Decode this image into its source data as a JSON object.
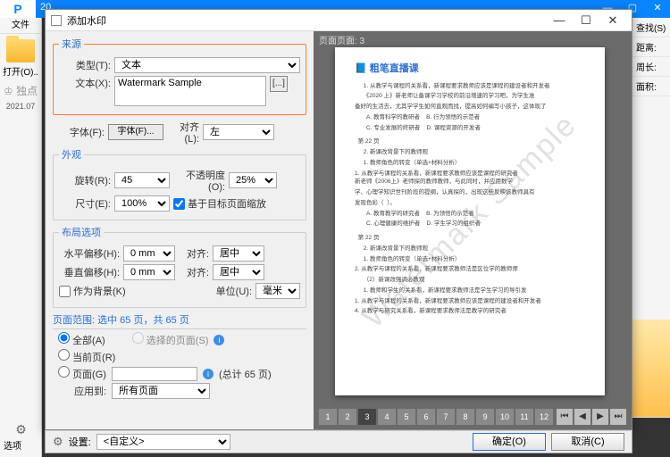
{
  "backwin": {
    "logo": "P",
    "title": "20.",
    "find": "查找(S)"
  },
  "leftstrip": {
    "file": "文件",
    "open": "打开(O)..",
    "excl": "独点",
    "date": "2021.07",
    "opt": "选项"
  },
  "rightstrip": {
    "dist": "距离:",
    "perim": "周长:",
    "area": "面积:"
  },
  "dlg": {
    "title": "添加水印",
    "source": {
      "legend": "来源",
      "type_lbl": "类型(T):",
      "type_val": "文本",
      "text_lbl": "文本(X):",
      "text_val": "Watermark Sample",
      "font_lbl": "字体(F):",
      "font_btn": "字体(F)...",
      "align_lbl": "对齐(L):",
      "align_val": "左"
    },
    "appearance": {
      "legend": "外观",
      "rotate_lbl": "旋转(R):",
      "rotate_val": "45",
      "opacity_lbl": "不透明度(O):",
      "opacity_val": "25%",
      "size_lbl": "尺寸(E):",
      "size_val": "100%",
      "scale_chk": "基于目标页面缩放"
    },
    "layout": {
      "legend": "布局选项",
      "hoff_lbl": "水平偏移(H):",
      "hoff_val": "0 mm",
      "halign_lbl": "对齐:",
      "halign_val": "居中",
      "voff_lbl": "垂直偏移(H):",
      "voff_val": "0 mm",
      "valign_lbl": "对齐:",
      "valign_val": "居中",
      "asbg": "作为背景(K)",
      "unit_lbl": "单位(U):",
      "unit_val": "毫米"
    },
    "range": {
      "title": "页面范围: 选中 65 页，共 65 页",
      "all": "全部(A)",
      "selected": "选择的页面(S)",
      "current": "当前页(R)",
      "pages": "页面(G)",
      "total": "(总计 65 页)",
      "apply_lbl": "应用到:",
      "apply_val": "所有页面"
    },
    "preview_hdr": "页面页面: 3",
    "page_brand": "粗笔直播课",
    "watermark_text": "Watermark Sample",
    "pager": {
      "pages": [
        "1",
        "2",
        "3",
        "4",
        "5",
        "6",
        "7",
        "8",
        "9",
        "10",
        "11",
        "12"
      ],
      "current": "3"
    }
  },
  "footer": {
    "settings_lbl": "设置:",
    "preset": "<自定义>",
    "ok": "确定(O)",
    "cancel": "取消(C)"
  }
}
